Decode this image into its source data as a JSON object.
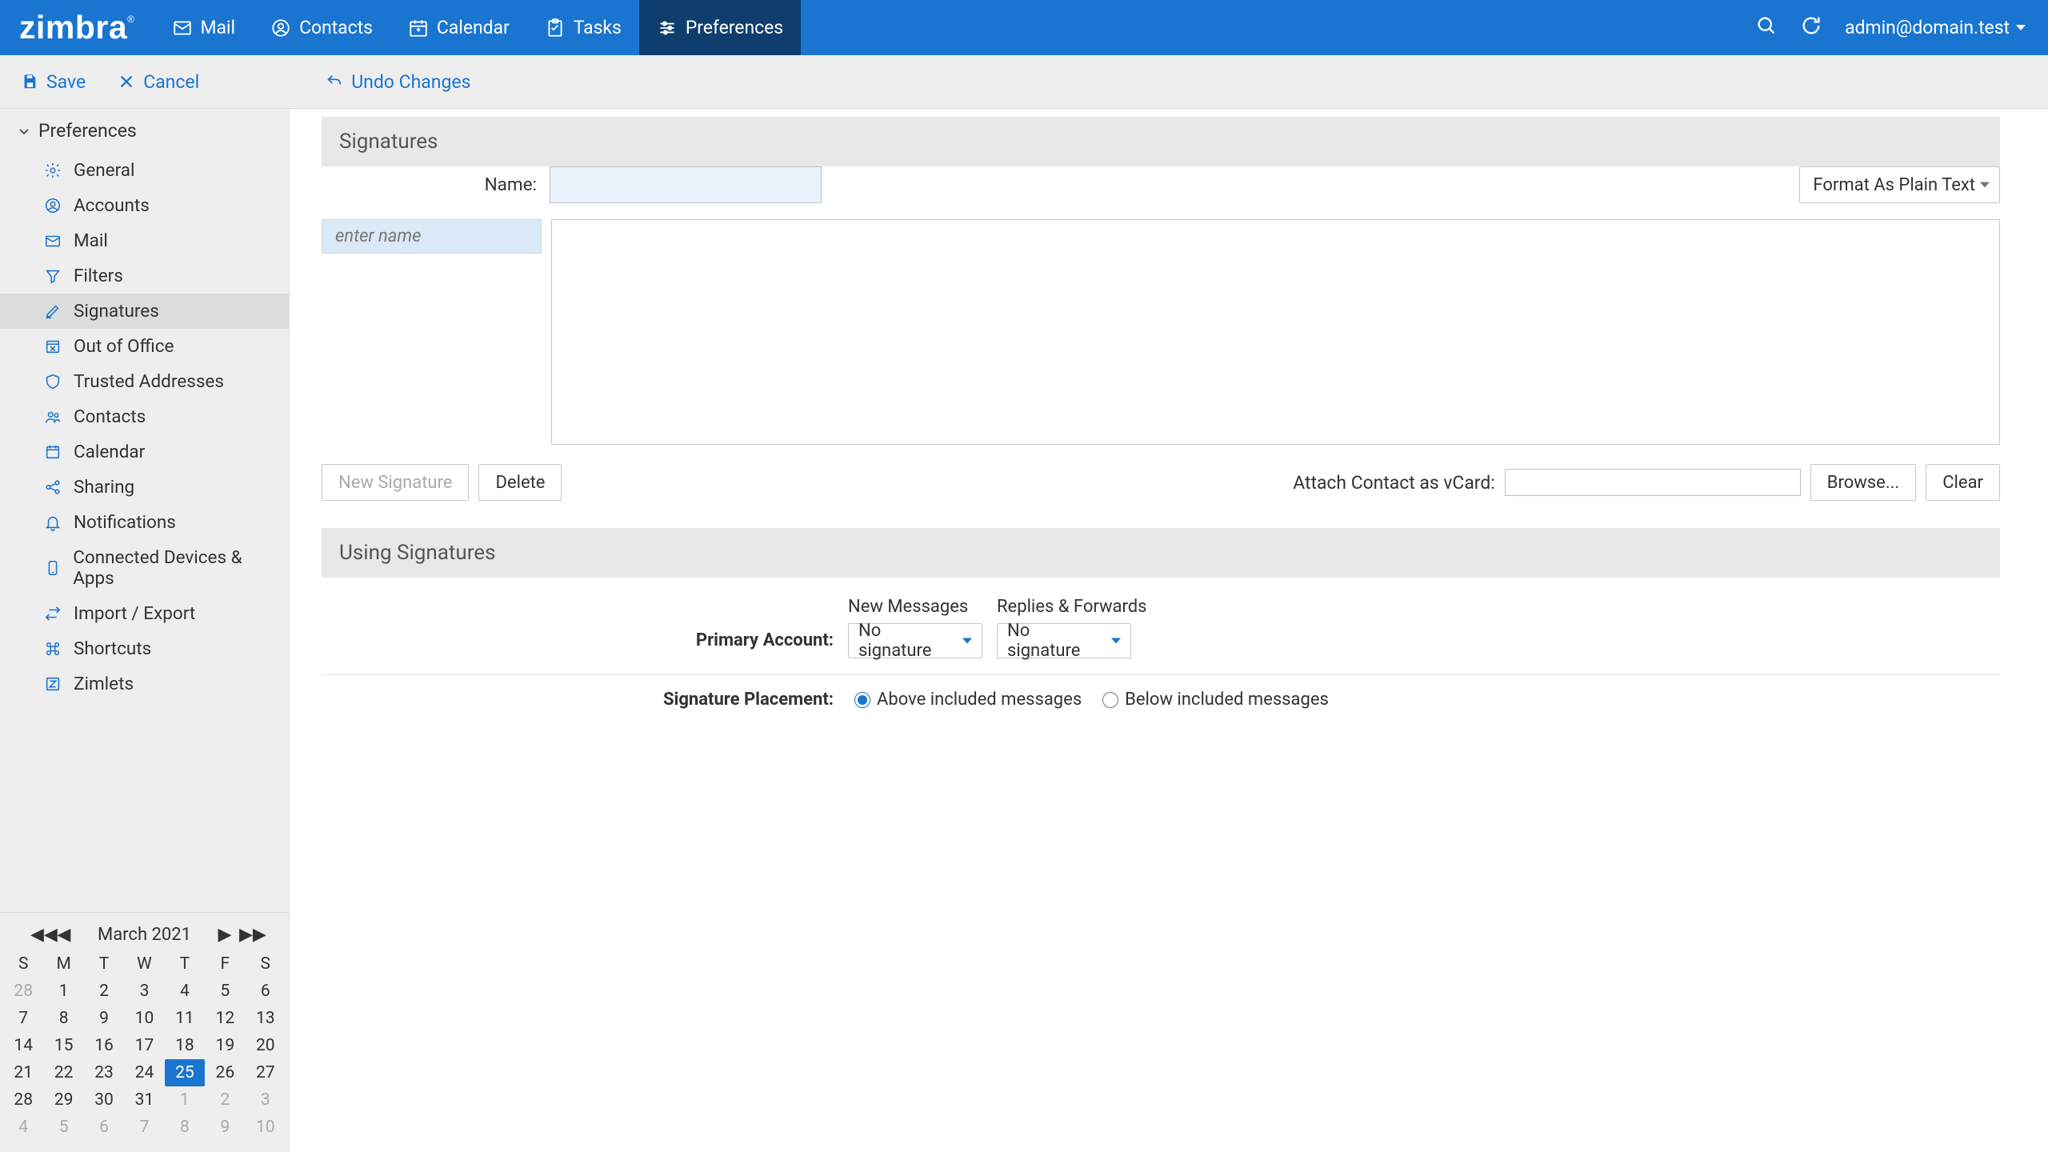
{
  "brand": {
    "name": "zimbra"
  },
  "topnav": {
    "items": [
      {
        "id": "mail",
        "label": "Mail"
      },
      {
        "id": "contacts",
        "label": "Contacts"
      },
      {
        "id": "calendar",
        "label": "Calendar"
      },
      {
        "id": "tasks",
        "label": "Tasks"
      },
      {
        "id": "preferences",
        "label": "Preferences"
      }
    ],
    "active": "preferences"
  },
  "user": {
    "email": "admin@domain.test"
  },
  "actionbar": {
    "save": "Save",
    "cancel": "Cancel",
    "undo": "Undo Changes"
  },
  "sidebar": {
    "header": "Preferences",
    "items": [
      {
        "id": "general",
        "label": "General",
        "icon": "gear"
      },
      {
        "id": "accounts",
        "label": "Accounts",
        "icon": "user-circle"
      },
      {
        "id": "mail",
        "label": "Mail",
        "icon": "mail"
      },
      {
        "id": "filters",
        "label": "Filters",
        "icon": "funnel"
      },
      {
        "id": "signatures",
        "label": "Signatures",
        "icon": "pen"
      },
      {
        "id": "ooo",
        "label": "Out of Office",
        "icon": "calendar-x"
      },
      {
        "id": "trusted",
        "label": "Trusted Addresses",
        "icon": "shield"
      },
      {
        "id": "contacts",
        "label": "Contacts",
        "icon": "people"
      },
      {
        "id": "calendar",
        "label": "Calendar",
        "icon": "calendar"
      },
      {
        "id": "sharing",
        "label": "Sharing",
        "icon": "share"
      },
      {
        "id": "notifications",
        "label": "Notifications",
        "icon": "bell"
      },
      {
        "id": "devices",
        "label": "Connected Devices & Apps",
        "icon": "device"
      },
      {
        "id": "importexport",
        "label": "Import / Export",
        "icon": "swap"
      },
      {
        "id": "shortcuts",
        "label": "Shortcuts",
        "icon": "command"
      },
      {
        "id": "zimlets",
        "label": "Zimlets",
        "icon": "z-square"
      }
    ],
    "selected": "signatures"
  },
  "signatures": {
    "section_title": "Signatures",
    "name_label": "Name:",
    "name_value": "",
    "list_placeholder": "enter name",
    "format_label": "Format As Plain Text",
    "new_btn": "New Signature",
    "delete_btn": "Delete",
    "vcard_label": "Attach Contact as vCard:",
    "browse_btn": "Browse...",
    "clear_btn": "Clear"
  },
  "using": {
    "section_title": "Using Signatures",
    "new_messages_hdr": "New Messages",
    "replies_hdr": "Replies & Forwards",
    "primary_account_label": "Primary Account:",
    "no_signature": "No signature",
    "placement_label": "Signature Placement:",
    "opt_above": "Above included messages",
    "opt_below": "Below included messages",
    "placement_selected": "above"
  },
  "minical": {
    "title": "March 2021",
    "dow": [
      "S",
      "M",
      "T",
      "W",
      "T",
      "F",
      "S"
    ],
    "weeks": [
      [
        {
          "d": 28,
          "dim": true
        },
        {
          "d": 1
        },
        {
          "d": 2
        },
        {
          "d": 3
        },
        {
          "d": 4
        },
        {
          "d": 5
        },
        {
          "d": 6
        }
      ],
      [
        {
          "d": 7
        },
        {
          "d": 8
        },
        {
          "d": 9
        },
        {
          "d": 10
        },
        {
          "d": 11
        },
        {
          "d": 12
        },
        {
          "d": 13
        }
      ],
      [
        {
          "d": 14
        },
        {
          "d": 15
        },
        {
          "d": 16
        },
        {
          "d": 17
        },
        {
          "d": 18
        },
        {
          "d": 19
        },
        {
          "d": 20
        }
      ],
      [
        {
          "d": 21
        },
        {
          "d": 22
        },
        {
          "d": 23
        },
        {
          "d": 24
        },
        {
          "d": 25,
          "today": true
        },
        {
          "d": 26
        },
        {
          "d": 27
        }
      ],
      [
        {
          "d": 28
        },
        {
          "d": 29
        },
        {
          "d": 30
        },
        {
          "d": 31
        },
        {
          "d": 1,
          "dim": true
        },
        {
          "d": 2,
          "dim": true
        },
        {
          "d": 3,
          "dim": true
        }
      ],
      [
        {
          "d": 4,
          "dim": true
        },
        {
          "d": 5,
          "dim": true
        },
        {
          "d": 6,
          "dim": true
        },
        {
          "d": 7,
          "dim": true
        },
        {
          "d": 8,
          "dim": true
        },
        {
          "d": 9,
          "dim": true
        },
        {
          "d": 10,
          "dim": true
        }
      ]
    ]
  }
}
